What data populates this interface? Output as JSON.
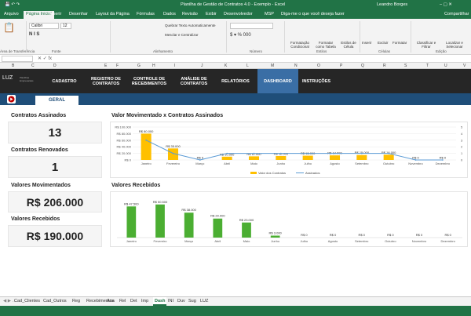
{
  "window": {
    "title": "Planilha de Gestão de Contratos 4.0 - Exemplo  -  Excel",
    "user": "Leandro Borges"
  },
  "menu": {
    "items": [
      "Arquivo",
      "Página Inicial",
      "Inserir",
      "Desenhar",
      "Layout da Página",
      "Fórmulas",
      "Dados",
      "Revisão",
      "Exibir",
      "Desenvolvedor",
      "MSP"
    ],
    "active_index": 1,
    "tell_me": "Diga-me o que você deseja fazer",
    "share": "Compartilhar"
  },
  "ribbon": {
    "font_name": "Calibri",
    "font_size": "12",
    "wrap_text": "Quebrar Texto Automaticamente",
    "merge_center": "Mesclar e Centralizar",
    "conditional": "Formatação Condicional",
    "format_table": "Formatar como Tabela",
    "styles": "Estilos de Célula",
    "insert": "Inserir",
    "delete": "Excluir",
    "format": "Formatar",
    "sort": "Classificar e Filtrar",
    "find": "Localizar e Selecionar",
    "groups": {
      "clipboard": "Área de Transferência",
      "font": "Fonte",
      "alignment": "Alinhamento",
      "number": "Número",
      "styles": "Estilos",
      "cells": "Células",
      "editing": "Edição"
    }
  },
  "columns": [
    "B",
    "C",
    "D",
    "E",
    "F",
    "G",
    "H",
    "I",
    "J",
    "K",
    "L",
    "M",
    "N",
    "O",
    "P",
    "Q",
    "R",
    "S",
    "T",
    "U",
    "V"
  ],
  "nav": {
    "logo": "LUZ",
    "logo_sub": "Planilhas Empresariais",
    "items": [
      "CADASTRO",
      "REGISTRO DE CONTRATOS",
      "CONTROLE DE RECEBIMENTOS",
      "ANÁLISE DE CONTRATOS",
      "RELATÓRIOS",
      "DASHBOARD",
      "INSTRUÇÕES"
    ],
    "active_index": 5
  },
  "subnav": {
    "tab": "GERAL"
  },
  "kpis": {
    "contratos_assinados_label": "Contratos Assinados",
    "contratos_assinados": "13",
    "contratos_renovados_label": "Contratos Renovados",
    "contratos_renovados": "1",
    "valores_movimentados_label": "Valores Movimentados",
    "valores_movimentados": "R$ 206.000",
    "valores_recebidos_label": "Valores Recebidos",
    "valores_recebidos": "R$ 190.000"
  },
  "chart_data": [
    {
      "type": "bar",
      "title": "Valor Movimentado x Contratos Assinados",
      "categories": [
        "Janeiro",
        "Fevereiro",
        "Março",
        "Abril",
        "Maio",
        "Junho",
        "Julho",
        "Agosto",
        "Setembro",
        "Outubro",
        "Novembro",
        "Dezembro"
      ],
      "series": [
        {
          "name": "Valor dos Contratos",
          "type": "bar",
          "values": [
            80000,
            35000,
            0,
            10000,
            11000,
            12000,
            13000,
            14000,
            15000,
            16000,
            0,
            0
          ],
          "labels": [
            "R$ 80.000",
            "R$ 35.000",
            "R$ 0",
            "R$ 10.000",
            "R$ 11.000",
            "R$ 12.000",
            "R$ 13.000",
            "R$ 14.000",
            "R$ 15.000",
            "R$ 16.000",
            "R$ 0",
            "R$ 0"
          ],
          "color": "#ffc000"
        },
        {
          "name": "Assinados",
          "type": "line",
          "axis": "right",
          "values": [
            3,
            1,
            0,
            1,
            1,
            1,
            1,
            1,
            1,
            1,
            0,
            0
          ],
          "color": "#5b9bd5"
        }
      ],
      "yticks": [
        "R$ 0",
        "R$ 20.000",
        "R$ 40.000",
        "R$ 60.000",
        "R$ 80.000",
        "R$ 100.000"
      ],
      "ylim": [
        0,
        100000
      ],
      "y2ticks": [
        "0",
        "1",
        "2",
        "3",
        "4",
        "5"
      ],
      "y2lim": [
        0,
        5
      ],
      "legend": "bottom"
    },
    {
      "type": "bar",
      "title": "Valores Recebidos",
      "categories": [
        "Janeiro",
        "Fevereiro",
        "Março",
        "Abril",
        "Maio",
        "Junho",
        "Julho",
        "Agosto",
        "Setembro",
        "Outubro",
        "Novembro",
        "Dezembro"
      ],
      "series": [
        {
          "name": "",
          "values": [
            47500,
            50500,
            38000,
            29000,
            23000,
            3000,
            0,
            0,
            0,
            0,
            0,
            0
          ],
          "labels": [
            "R$ 47.500",
            "R$ 50.500",
            "R$ 38.000",
            "R$ 29.000",
            "R$ 23.000",
            "R$ 3.000",
            "R$ 0",
            "R$ 0",
            "R$ 0",
            "R$ 0",
            "R$ 0",
            "R$ 0"
          ],
          "color": "#4bae32"
        }
      ],
      "ylim": [
        0,
        55000
      ]
    }
  ],
  "sheets": {
    "items": [
      "Cad_Clientes",
      "Cad_Outros",
      "Reg",
      "Recebimentos",
      "Ana",
      "Rel",
      "Det",
      "Imp",
      "Dash",
      "INI",
      "Duv",
      "Sug",
      "LUZ"
    ],
    "active_index": 8
  }
}
